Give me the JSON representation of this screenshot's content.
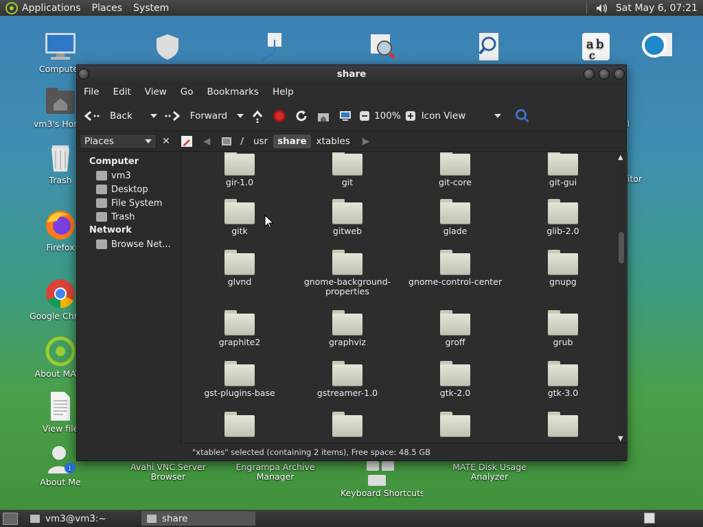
{
  "top_panel": {
    "menus": [
      "Applications",
      "Places",
      "System"
    ],
    "clock": "Sat May  6, 07:21"
  },
  "desktop_icons": [
    {
      "label": "Computer",
      "icon": "computer-icon"
    },
    {
      "label": "vm3's Home",
      "icon": "home-folder-icon"
    },
    {
      "label": "Trash",
      "icon": "trash-icon"
    },
    {
      "label": "Firefox",
      "icon": "firefox-icon"
    },
    {
      "label": "Google Chrome",
      "icon": "chrome-icon"
    },
    {
      "label": "About MATE",
      "icon": "mate-icon"
    },
    {
      "label": "View file",
      "icon": "text-file-icon"
    },
    {
      "label": "About Me",
      "icon": "about-me-icon"
    },
    {
      "label": "Avahi VNC Server Browser",
      "icon": "avahi-icon"
    },
    {
      "label": "Engrampa Archive Manager",
      "icon": "archive-icon"
    },
    {
      "label": "Keyboard Shortcuts",
      "icon": "keyboard-shortcuts-icon"
    },
    {
      "label": "MATE Disk Usage Analyzer",
      "icon": "disk-usage-icon"
    },
    {
      "label": "ol",
      "icon": "partial-icon"
    },
    {
      "label": "nitor",
      "icon": "partial-icon"
    },
    {
      "label": "e",
      "icon": "partial-icon"
    }
  ],
  "window": {
    "title": "share",
    "menu": [
      "File",
      "Edit",
      "View",
      "Go",
      "Bookmarks",
      "Help"
    ],
    "toolbar": {
      "back": "Back",
      "forward": "Forward",
      "zoom": "100%",
      "view_mode": "Icon View"
    },
    "places_combo": "Places",
    "breadcrumbs": [
      "/",
      "usr",
      "share",
      "xtables"
    ],
    "active_crumb": "share",
    "sidebar": {
      "computer_heading": "Computer",
      "computer_items": [
        "vm3",
        "Desktop",
        "File System",
        "Trash"
      ],
      "network_heading": "Network",
      "network_items": [
        "Browse Net..."
      ]
    },
    "folders": [
      "gir-1.0",
      "git",
      "git-core",
      "git-gui",
      "gitk",
      "gitweb",
      "glade",
      "glib-2.0",
      "glvnd",
      "gnome-background-properties",
      "gnome-control-center",
      "gnupg",
      "graphite2",
      "graphviz",
      "groff",
      "grub",
      "gst-plugins-base",
      "gstreamer-1.0",
      "gtk-2.0",
      "gtk-3.0",
      "",
      "",
      "",
      ""
    ],
    "status": "\"xtables\" selected (containing 2 items), Free space: 48.5 GB"
  },
  "bottom_panel": {
    "tasks": [
      "vm3@vm3:~",
      "share"
    ]
  }
}
